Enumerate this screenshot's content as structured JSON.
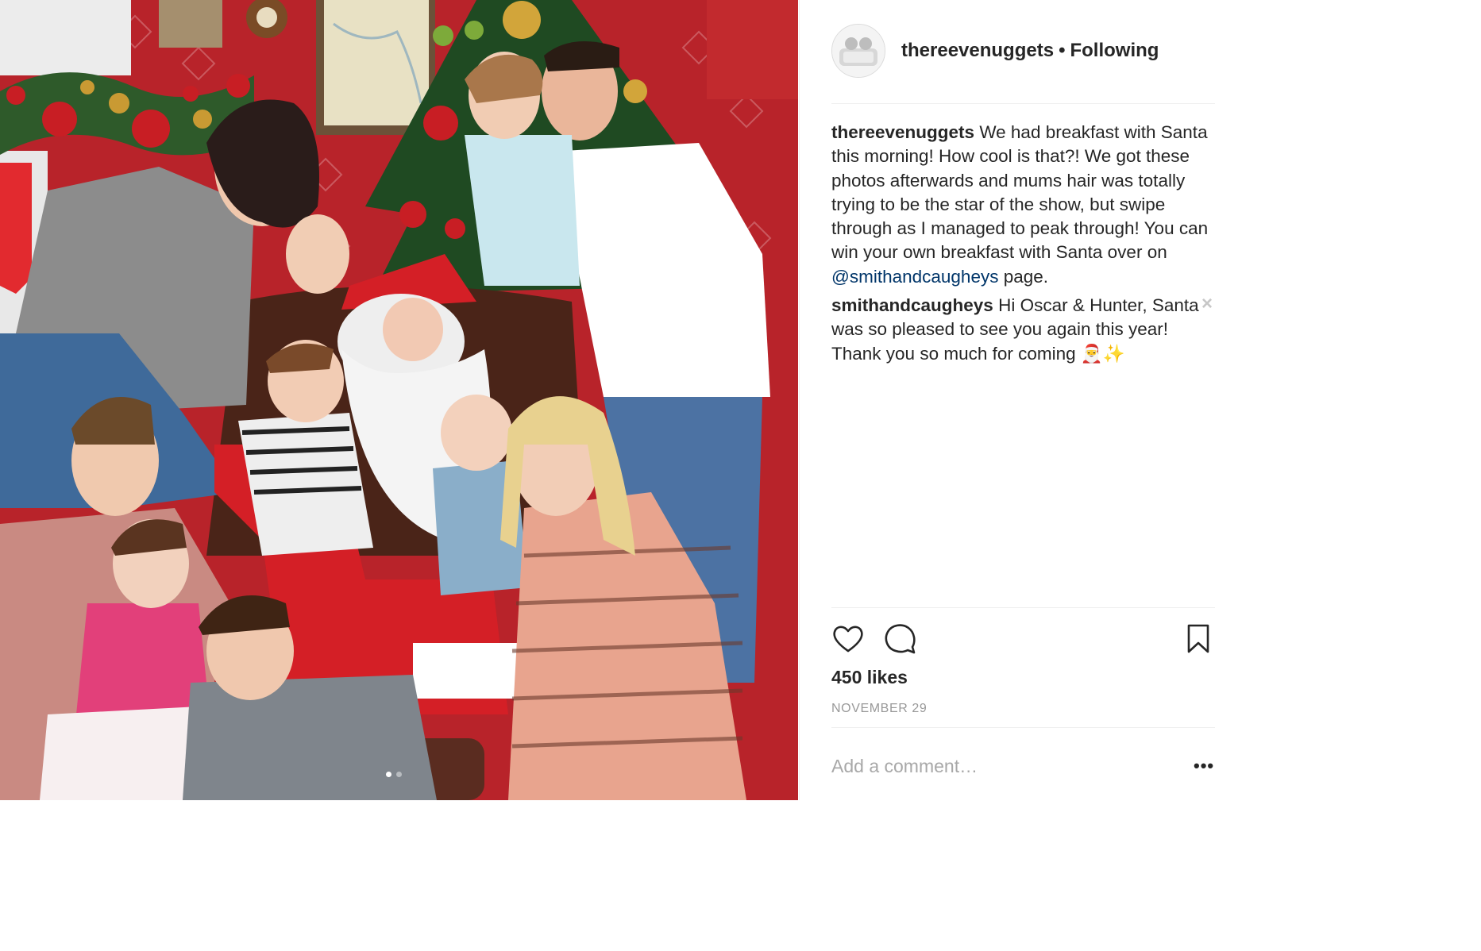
{
  "post": {
    "username": "thereevenuggets",
    "separator": "•",
    "follow_status": "Following",
    "avatar_icon": "profile-photo-avatar"
  },
  "photo": {
    "description_icon": "family-christmas-photo-with-santa",
    "slide_index": 1,
    "slide_count": 2
  },
  "caption": {
    "username": "thereevenuggets",
    "text_before_mention": "We had breakfast with Santa this morning! How cool is that?! We got these photos afterwards and mums hair was totally trying to be the star of the show, but swipe through as I managed to peak through! You can win your own breakfast with Santa over on",
    "mention": "@smithandcaugheys",
    "text_after_mention": "page."
  },
  "comments": [
    {
      "username": "smithandcaugheys",
      "text": "Hi Oscar & Hunter, Santa was so pleased to see you again this year! Thank you so much for coming 🎅✨",
      "close_glyph": "×"
    }
  ],
  "actions": {
    "like_icon": "heart-icon",
    "comment_icon": "speech-bubble-icon",
    "save_icon": "bookmark-icon"
  },
  "likes_text": "450 likes",
  "date_text": "NOVEMBER 29",
  "comment_input": {
    "placeholder": "Add a comment…",
    "value": ""
  },
  "more_options_glyph": "•••",
  "colors": {
    "text": "#262626",
    "muted": "#999999",
    "mention": "#003569",
    "border": "#efefef",
    "wallpaper_red": "#b8232a",
    "santa_red": "#d41f26"
  }
}
